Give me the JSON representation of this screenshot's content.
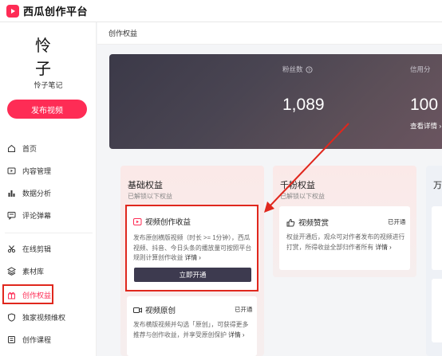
{
  "app": {
    "title": "西瓜创作平台"
  },
  "user": {
    "avatar_text": "怜子",
    "name": "怜子笔记"
  },
  "sidebar": {
    "publish_label": "发布视频",
    "items": [
      {
        "label": "首页",
        "icon": "home-icon"
      },
      {
        "label": "内容管理",
        "icon": "video-folder-icon"
      },
      {
        "label": "数据分析",
        "icon": "bar-chart-icon"
      },
      {
        "label": "评论弹幕",
        "icon": "comment-icon"
      },
      {
        "label": "在线剪辑",
        "icon": "scissors-icon"
      },
      {
        "label": "素材库",
        "icon": "layers-icon"
      },
      {
        "label": "创作权益",
        "icon": "gift-icon",
        "active": true
      },
      {
        "label": "独家视频维权",
        "icon": "shield-icon"
      },
      {
        "label": "创作课程",
        "icon": "book-icon"
      }
    ]
  },
  "breadcrumb": "创作权益",
  "stats": {
    "fans_label": "粉丝数",
    "fans_value": "1,089",
    "credit_label": "信用分",
    "credit_value": "100",
    "detail_label": "查看详情 ›"
  },
  "cards": {
    "basic": {
      "title": "基础权益",
      "subtitle": "已解锁以下权益",
      "features": [
        {
          "title": "视频创作收益",
          "desc": "发布原创横版视频（时长 >= 1分钟），西瓜视频、抖音、今日头条的播放量可按照平台规则计算创作收益",
          "link": "详情 ›",
          "button": "立即开通"
        },
        {
          "title": "视频原创",
          "tag": "已开通",
          "desc": "发布横版视频并勾选「原创」，可获得更多推荐与创作收益，并享受原创保护",
          "link": "详情 ›"
        }
      ]
    },
    "thousand": {
      "title": "千粉权益",
      "subtitle": "已解锁以下权益",
      "features": [
        {
          "title": "视频赞赏",
          "tag": "已开通",
          "desc": "权益开通后，观众可对作者发布的视频进行打赏，所得收益全部归作者所有",
          "link": "详情 ›"
        }
      ]
    },
    "third": {
      "title": "万"
    }
  },
  "colors": {
    "brand": "#fe2c55",
    "highlight": "#e0271d",
    "button_dark": "#3d3a4f"
  }
}
